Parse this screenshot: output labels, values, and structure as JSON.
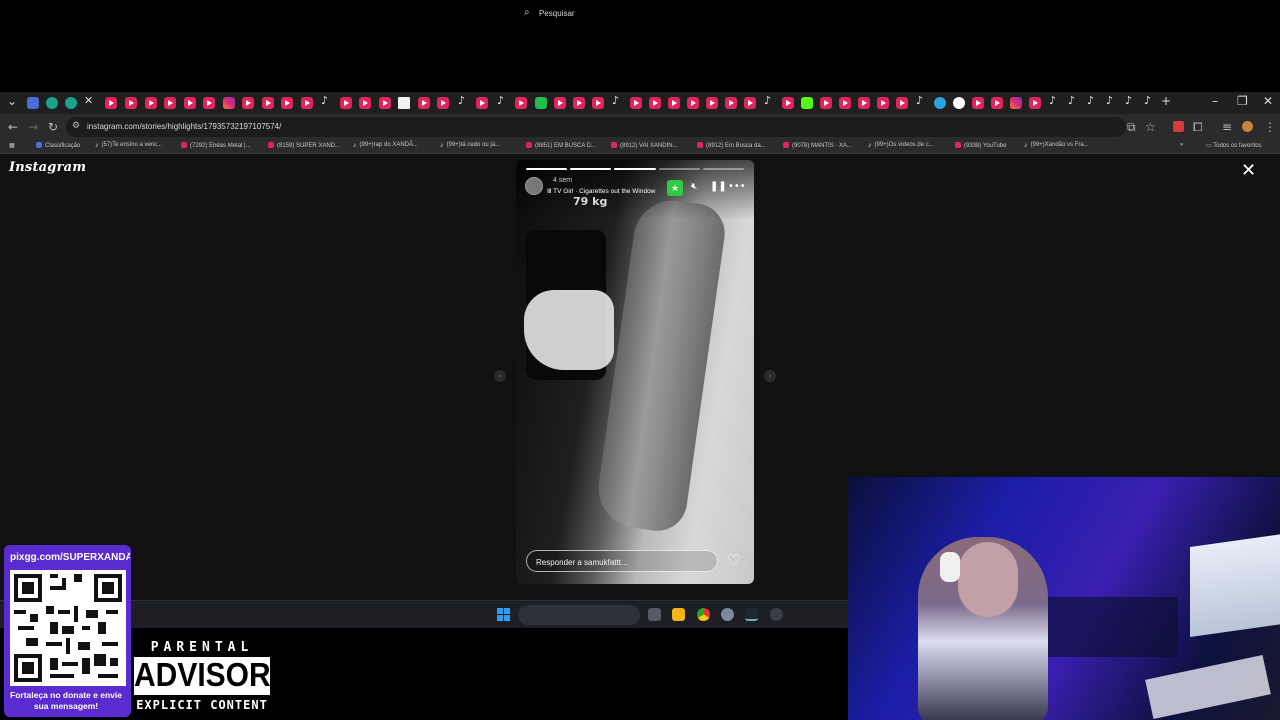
{
  "browser": {
    "url": "instagram.com/stories/highlights/17935732197107574/",
    "bookmarks": [
      "Classificação",
      "(57)Te ensino a venc...",
      "(7292) Enéas Metal |...",
      "(8159) SUPER XAND...",
      "(99+)rap do XANDÃ...",
      "(99+)tá cedo ou já...",
      "(8851) EM BUSCA D...",
      "(8912) VAI XANDIN...",
      "(8912) Em Busca da...",
      "(9078) MANTIS · XA...",
      "(99+)Os vídeos de c...",
      "(9338) YouTube",
      "(99+)Xandão vs Fra..."
    ],
    "all_bookmarks_label": "Todos os favoritos"
  },
  "instagram": {
    "logo": "Instagram",
    "story": {
      "time": "4 sem",
      "music": "TV Girl · Cigarettes out the Window",
      "overlay_text": "79 kg",
      "reply_placeholder": "Responder a samukfattt..."
    }
  },
  "taskbar": {
    "search_placeholder": "Pesquisar"
  },
  "overlay": {
    "qr_url": "pixgg.com/SUPERXANDÃO",
    "qr_message": "Fortaleça no donate e envie sua mensagem!",
    "advisory_top": "PARENTAL",
    "advisory_middle": "ADVISORY",
    "advisory_bottom": "EXPLICIT CONTENT"
  },
  "colors": {
    "accent_green": "#2ecc40",
    "qr_purple": "#5a2bd0",
    "windows_blue": "#2d9bf0"
  }
}
